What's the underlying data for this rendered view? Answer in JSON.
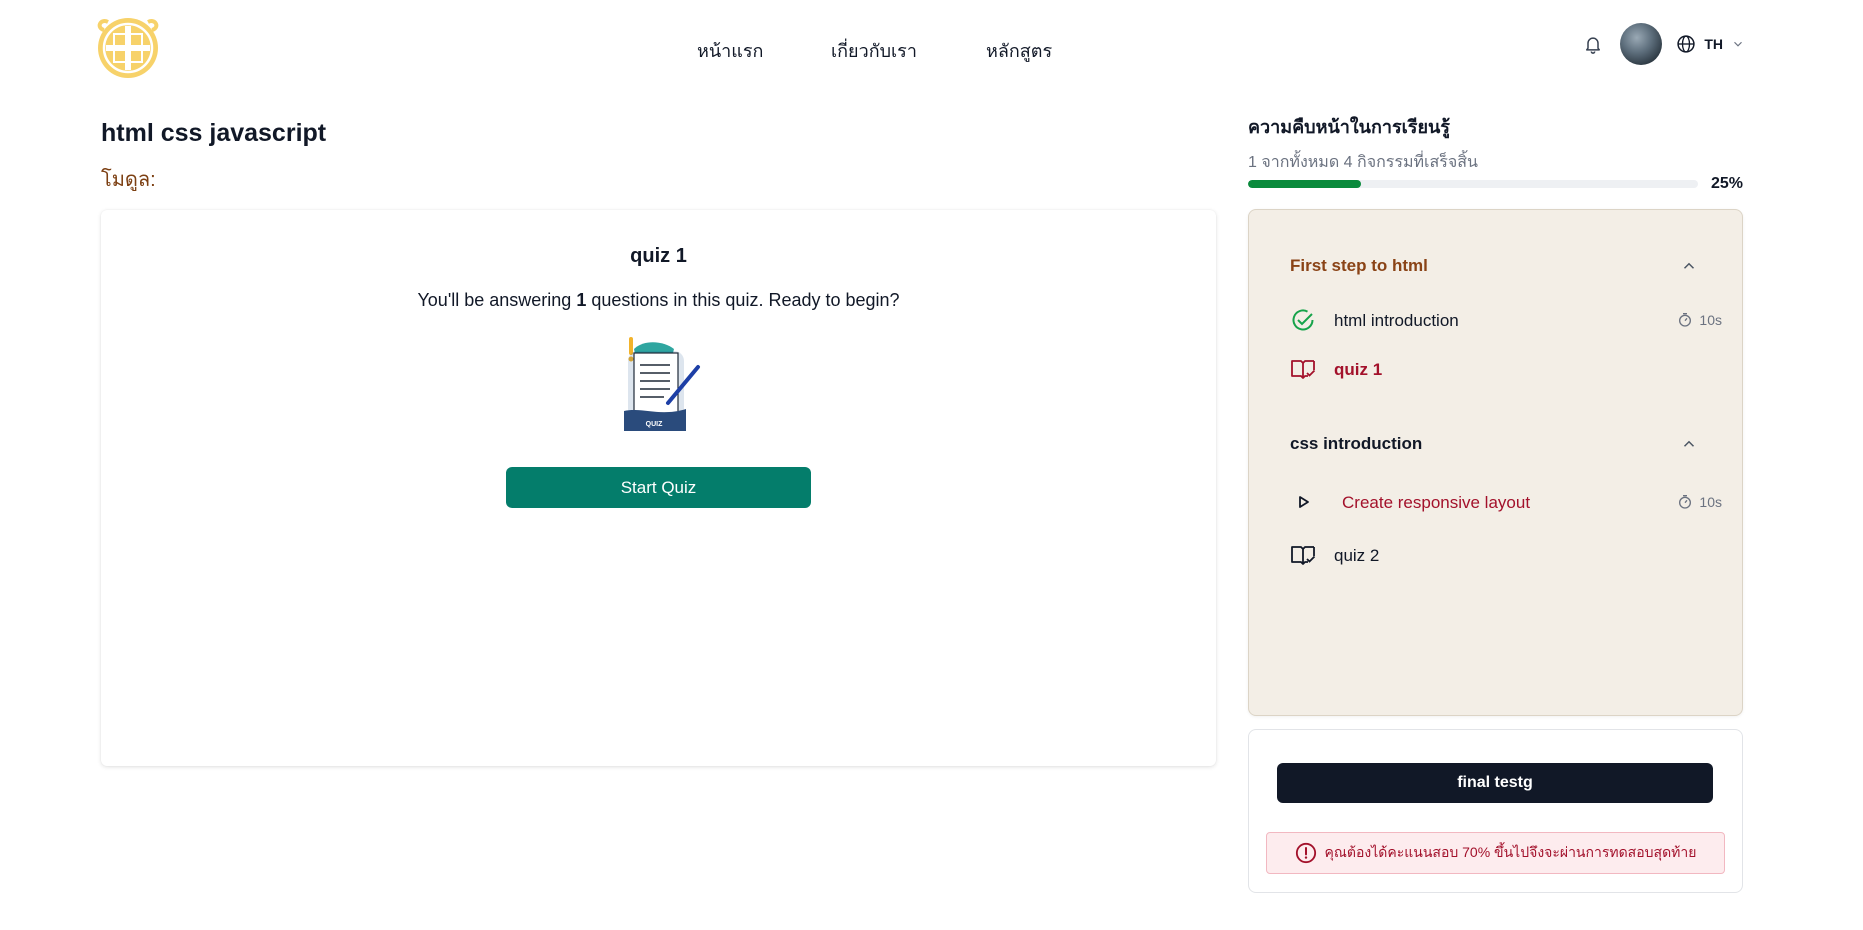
{
  "header": {
    "logo_name": "golden-emblem-logo",
    "nav": [
      {
        "label": "หน้าแรก"
      },
      {
        "label": "เกี่ยวกับเรา"
      },
      {
        "label": "หลักสูตร"
      }
    ],
    "language_code": "TH",
    "icons": {
      "notifications": "bell-icon",
      "language": "globe-icon",
      "language_toggle": "chevron-down-icon"
    }
  },
  "course": {
    "title": "html css javascript",
    "module_label": "โมดูล:"
  },
  "quiz": {
    "title": "quiz 1",
    "intro_prefix": "You'll be answering ",
    "question_count": "1",
    "intro_suffix": " questions in this quiz. Ready to begin?",
    "illustration_caption": "QUIZ",
    "start_label": "Start Quiz",
    "start_color": "#047d6b"
  },
  "progress": {
    "heading": "ความคืบหน้าในการเรียนรู้",
    "summary": "1 จากทั้งหมด 4 กิจกรรมที่เสร็จสิ้น",
    "percent": 25,
    "percent_label": "25%",
    "fill_color": "#0a8a3c"
  },
  "outline": {
    "sections": [
      {
        "title": "First step to html",
        "expanded": true,
        "items": [
          {
            "label": "html introduction",
            "icon": "check-circle-icon",
            "status": "completed",
            "duration": "10s"
          },
          {
            "label": "quiz 1",
            "icon": "open-book-check-icon",
            "status": "current"
          }
        ]
      },
      {
        "title": "css introduction",
        "expanded": true,
        "items": [
          {
            "label": "Create responsive layout",
            "icon": "play-icon",
            "status": "pending",
            "duration": "10s"
          },
          {
            "label": "quiz 2",
            "icon": "open-book-check-icon",
            "status": "locked"
          }
        ]
      }
    ]
  },
  "final_test": {
    "button_label": "final testg",
    "warning": "คุณต้องได้คะแนนสอบ 70% ขึ้นไปจึงจะผ่านการทดสอบสุดท้าย",
    "warning_icon": "alert-circle-icon"
  },
  "colors": {
    "accent_brown": "#8a4316",
    "accent_red": "#a3112b",
    "panel_bg": "#f3eee6",
    "dark_button": "#111827"
  }
}
